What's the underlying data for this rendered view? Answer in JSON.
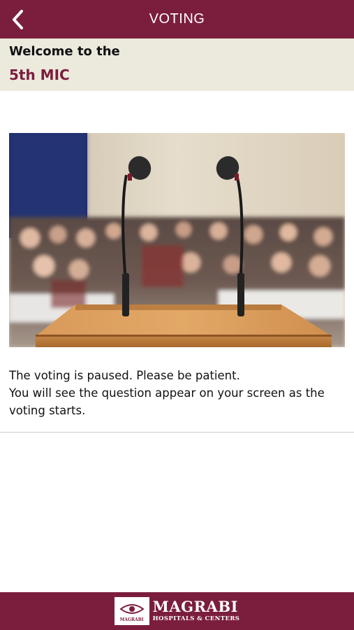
{
  "header": {
    "title": "VOTING",
    "back_icon": "chevron-left-icon"
  },
  "welcome": {
    "line1": "Welcome to the",
    "line2": "5th MIC"
  },
  "hero": {
    "image": "conference-podium-with-microphones"
  },
  "status": {
    "message": "The voting is paused. Please be patient.\n You will see the question appear on your screen as the voting starts."
  },
  "footer": {
    "logo_mark_text": "MAGRABI",
    "logo_name": "MAGRABI",
    "logo_subtitle": "HOSPITALS & CENTERS"
  },
  "colors": {
    "brand": "#7b1e3d",
    "welcome_bg": "#ece9dd"
  }
}
